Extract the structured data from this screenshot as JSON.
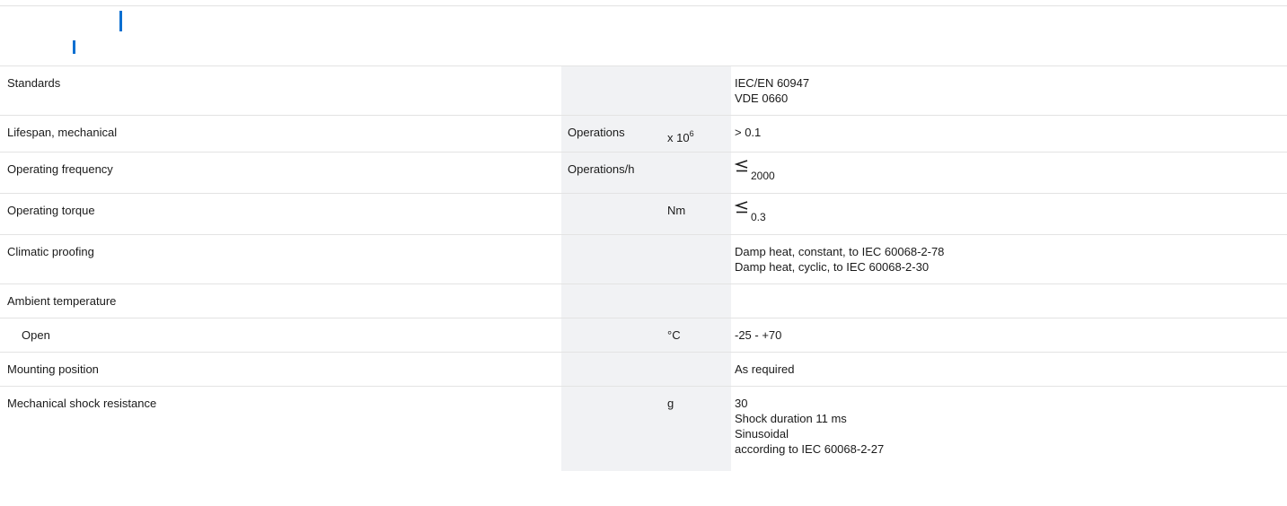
{
  "accent_color": "#0a6fd1",
  "rows": [
    {
      "label": "Standards",
      "unit": "",
      "multiplier": "",
      "values": [
        "IEC/EN 60947",
        "VDE 0660"
      ]
    },
    {
      "label": "Lifespan, mechanical",
      "unit": "Operations",
      "multiplier": "x 10",
      "multiplier_exp": "6",
      "values": [
        "> 0.1"
      ]
    },
    {
      "label": "Operating frequency",
      "unit": "Operations/h",
      "multiplier": "",
      "value_prefix_icon": "less-than-or-equal-icon",
      "value_number": "2000"
    },
    {
      "label": "Operating torque",
      "unit": "",
      "multiplier": "Nm",
      "value_prefix_icon": "less-than-or-equal-icon",
      "value_number": "0.3"
    },
    {
      "label": "Climatic proofing",
      "unit": "",
      "multiplier": "",
      "values": [
        "Damp heat, constant, to IEC 60068-2-78",
        "Damp heat, cyclic, to IEC 60068-2-30"
      ]
    },
    {
      "label": "Ambient temperature",
      "unit": "",
      "multiplier": "",
      "values": []
    },
    {
      "label": "Open",
      "unit": "",
      "multiplier": "°C",
      "values": [
        "-25 - +70"
      ]
    },
    {
      "label": "Mounting position",
      "unit": "",
      "multiplier": "",
      "values": [
        "As required"
      ]
    },
    {
      "label": "Mechanical shock resistance",
      "unit": "",
      "multiplier": "g",
      "values": [
        "30",
        "Shock duration 11 ms",
        "Sinusoidal",
        "according to IEC 60068-2-27"
      ]
    }
  ]
}
